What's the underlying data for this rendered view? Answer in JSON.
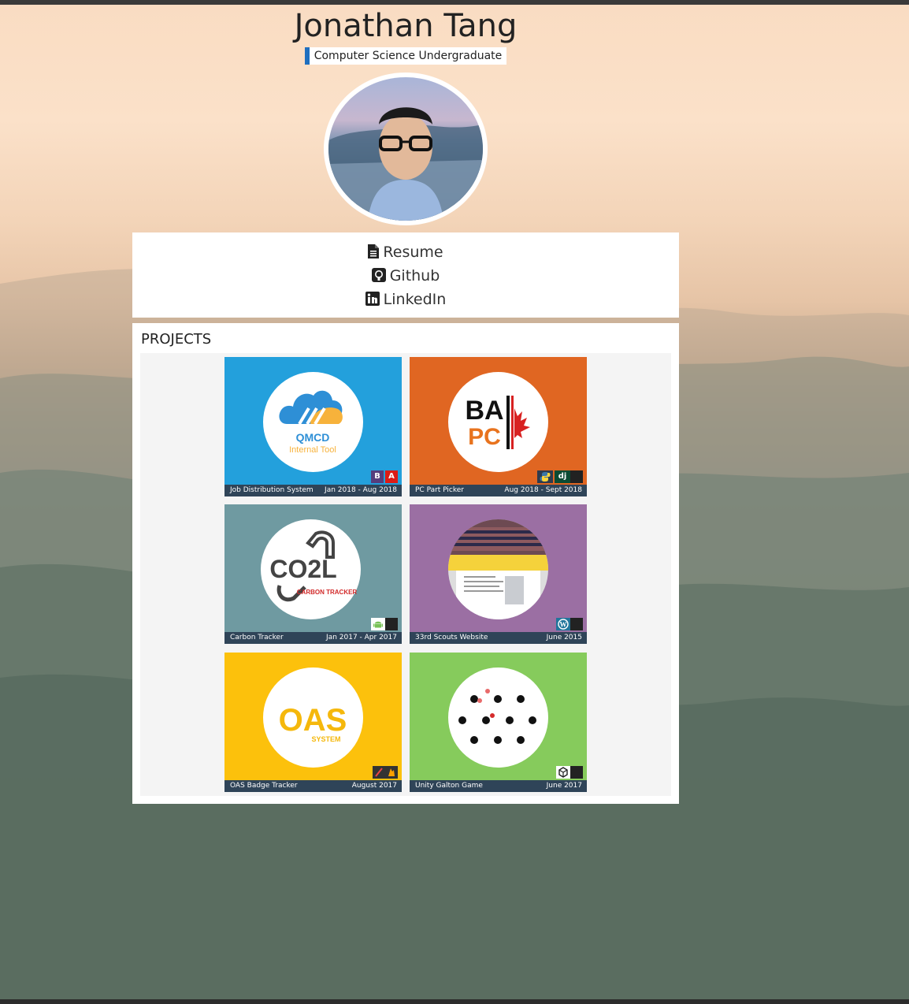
{
  "profile": {
    "name": "Jonathan Tang",
    "subtitle": "Computer Science Undergraduate"
  },
  "links": [
    {
      "label": "Resume",
      "icon": "file-icon"
    },
    {
      "label": "Github",
      "icon": "github-icon"
    },
    {
      "label": "LinkedIn",
      "icon": "linkedin-icon"
    }
  ],
  "projects": {
    "heading": "PROJECTS",
    "items": [
      {
        "title": "Job Distribution System",
        "date": "Jan 2018 - Aug 2018",
        "bg": "#23a0dc",
        "logo_text": "QMCD",
        "logo_sub": "Internal Tool",
        "badges": [
          "B",
          "A"
        ]
      },
      {
        "title": "PC Part Picker",
        "date": "Aug 2018 - Sept 2018",
        "bg": "#e06622",
        "logo_text": "BA",
        "logo_sub": "PC",
        "badges": [
          "dj"
        ]
      },
      {
        "title": "Carbon Tracker",
        "date": "Jan 2017 - Apr 2017",
        "bg": "#6f9aa1",
        "logo_text": "CO2L",
        "logo_sub": "CARBON TRACKER",
        "badges": []
      },
      {
        "title": "33rd Scouts Website",
        "date": "June 2015",
        "bg": "#9b6fa3",
        "logo_text": "",
        "logo_sub": "",
        "badges": []
      },
      {
        "title": "OAS Badge Tracker",
        "date": "August 2017",
        "bg": "#fcc10c",
        "logo_text": "OAS",
        "logo_sub": "SYSTEM",
        "badges": []
      },
      {
        "title": "Unity Galton Game",
        "date": "June 2017",
        "bg": "#86cb5c",
        "logo_text": "",
        "logo_sub": "",
        "badges": []
      }
    ]
  },
  "colors": {
    "accent": "#1f6fbf",
    "caption_bg": "#2f4458"
  }
}
